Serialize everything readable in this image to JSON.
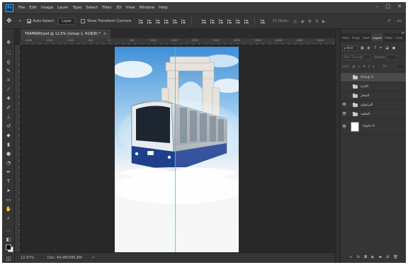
{
  "app": {
    "logo": "Ps",
    "window_controls": [
      "–",
      "□",
      "✕"
    ]
  },
  "menu": [
    "File",
    "Edit",
    "Image",
    "Layer",
    "Type",
    "Select",
    "Filter",
    "3D",
    "View",
    "Window",
    "Help"
  ],
  "options_bar": {
    "auto_select_label": "Auto-Select:",
    "auto_select_checked": true,
    "auto_select_value": "Layer",
    "show_transform_label": "Show Transform Controls",
    "show_transform_checked": false,
    "mode_3d_label": "3D Mode:"
  },
  "document": {
    "tab_title": "TRAMWAY.psd @ 12,5% (Group 1, RGB/8) *",
    "close_label": "×",
    "ruler_marks": [
      "-2000",
      "-1500",
      "-1000",
      "-500",
      "0",
      "500",
      "1000",
      "1500",
      "2000",
      "2500",
      "3000",
      "3500",
      "4000",
      "4500",
      "5000"
    ]
  },
  "status": {
    "zoom": "12,47%",
    "doc_info": "Doc: 44,9M/395,8M",
    "arrow": ">"
  },
  "layers_panel": {
    "tabs": [
      {
        "label": "Histo",
        "active": false
      },
      {
        "label": "Props",
        "active": false
      },
      {
        "label": "Swat",
        "active": false
      },
      {
        "label": "Layers",
        "active": true
      },
      {
        "label": "Paths",
        "active": false
      },
      {
        "label": "Chan",
        "active": false
      }
    ],
    "filter_kind": "ρ Kind",
    "blend_mode": "Pass Through",
    "opacity_label": "Opacity:",
    "lock_label": "Lock:",
    "fill_label": "Fill:",
    "layers": [
      {
        "name": "Group 1",
        "type": "group",
        "visible": false,
        "selected": true
      },
      {
        "name": "الإنارة",
        "type": "group",
        "visible": false,
        "selected": false
      },
      {
        "name": "الشعار",
        "type": "group",
        "visible": false,
        "selected": false
      },
      {
        "name": "الترامواي",
        "type": "group",
        "visible": true,
        "selected": false
      },
      {
        "name": "الخلفية",
        "type": "group",
        "visible": true,
        "selected": false
      },
      {
        "name": "Layer 0",
        "type": "pixel",
        "visible": true,
        "selected": false
      }
    ]
  },
  "colors": {
    "accent": "#31a8ff",
    "guide": "#29d0d0",
    "tram_blue": "#1f3e8c"
  }
}
